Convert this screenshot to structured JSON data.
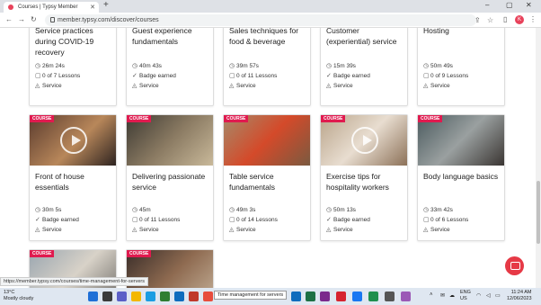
{
  "browser": {
    "tab_title": "Courses | Typsy Member",
    "url": "member.typsy.com/discover/courses",
    "status_url": "https://member.typsy.com/courses/time-management-for-servers"
  },
  "courses_top": [
    {
      "title": "Service practices during COVID-19 recovery",
      "duration": "26m 24s",
      "progress": "0 of 7 Lessons",
      "category": "Service"
    },
    {
      "title": "Guest experience fundamentals",
      "duration": "40m 43s",
      "progress": "Badge earned",
      "category": "Service"
    },
    {
      "title": "Sales techniques for food & beverage",
      "duration": "39m 57s",
      "progress": "0 of 11 Lessons",
      "category": "Service"
    },
    {
      "title": "Customer (experiential) service",
      "duration": "15m 39s",
      "progress": "Badge earned",
      "category": "Service"
    },
    {
      "title": "Hosting",
      "duration": "50m 49s",
      "progress": "0 of 9 Lessons",
      "category": "Service"
    }
  ],
  "courses_mid": [
    {
      "badge": "COURSE",
      "title": "Front of house essentials",
      "duration": "30m 5s",
      "progress": "Badge earned",
      "category": "Service"
    },
    {
      "badge": "COURSE",
      "title": "Delivering passionate service",
      "duration": "45m",
      "progress": "0 of 11 Lessons",
      "category": "Service"
    },
    {
      "badge": "COURSE",
      "title": "Table service fundamentals",
      "duration": "49m 3s",
      "progress": "0 of 14 Lessons",
      "category": "Service"
    },
    {
      "badge": "COURSE",
      "title": "Exercise tips for hospitality workers",
      "duration": "50m 13s",
      "progress": "Badge earned",
      "category": "Service"
    },
    {
      "badge": "COURSE",
      "title": "Body language basics",
      "duration": "33m 42s",
      "progress": "0 of 6 Lessons",
      "category": "Service"
    }
  ],
  "courses_bottom": [
    {
      "badge": "COURSE"
    },
    {
      "badge": "COURSE"
    }
  ],
  "tooltip": "Time management for servers",
  "taskbar": {
    "temp": "13°C",
    "weather": "Mostly cloudy",
    "lang_1": "ENG",
    "lang_2": "US",
    "time": "11:24 AM",
    "date": "12/06/2023"
  },
  "colors": {
    "accent": "#e01a4f",
    "chat": "#e63946"
  }
}
